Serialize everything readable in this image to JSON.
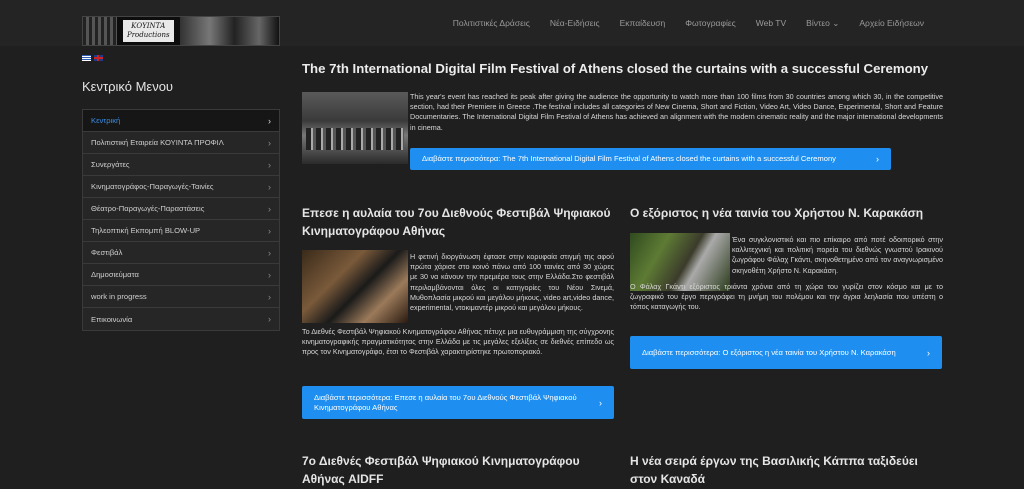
{
  "header": {
    "logo_text": "ΚΟΥΙΝΤΑ\nProductions",
    "nav": [
      "Πολιτιστικές Δράσεις",
      "Νέα-Ειδήσεις",
      "Εκπαίδευση",
      "Φωτογραφίες",
      "Web TV",
      "Βίντεο ⌄",
      "Αρχείο Ειδήσεων"
    ]
  },
  "sidebar": {
    "title": "Κεντρικό Μενου",
    "items": [
      "Κεντρική",
      "Πολιτιστική Εταιρεία ΚΟΥΙΝΤΑ ΠΡΟΦΙΛ",
      "Συνεργάτες",
      "Κινηματογράφος-Παραγωγές-Ταινίες",
      "Θέατρο-Παραγωγές-Παραστάσεις",
      "Τηλεοπτική Εκπομπή BLOW-UP",
      "Φεστιβάλ",
      "Δημοσιεύματα",
      "work in progress",
      "Επικοινωνία"
    ]
  },
  "articles": {
    "main": {
      "title": "The 7th International Digital Film Festival of Athens closed the curtains with a successful Ceremony",
      "text": "This year's event has reached its peak after giving the audience the opportunity to watch more than 100 films from 30 countries among which 30, in the competitive section, had their Premiere in Greece .The festival includes all categories of New Cinema, Short and Fiction, Video Art, Video Dance, Experimental, Short and Feature Documentaries. The International Digital Film Festival of Athens has achieved an alignment with the modern cinematic reality and the major international developments in cinema.",
      "button": "Διαβάστε περισσότερα: The 7th International Digital Film Festival of Athens closed the curtains with a successful Ceremony"
    },
    "left": {
      "title": "Επεσε η αυλαία του 7ου Διεθνούς Φεστιβάλ Ψηφιακού Κινηματογράφου Αθήνας",
      "text1": "Η φετινή  διοργάνωση έφτασε στην κορυφαία στιγμή της αφού πρώτα χάρισε στο  κοινό πάνω από 100 ταινίες από 30 χώρες με 30 να κάνουν την πρεμιέρα τους στην Ελλάδα.Στο φεστιβάλ περιλαμβάνονται όλες οι κατηγορίες του Νέου Σινεμά, Μυθοπλασία μικρού και μεγάλου μήκους, video art,video dance, experimental, ντοκιμαντέρ μικρού και μεγάλου μήκους.",
      "text2": "Το Διεθνές Φεστιβάλ Ψηφιακού Κινηματογράφου Αθήνας πέτυχε μια  ευθυγράμμιση της σύγχρονης κινηματογραφικής πραγματικότητας στην Ελλάδα με τις μεγάλες εξελίξεις σε διεθνές επίπεδο ως προς τον Κινηματογράφο, έτσι το Φεστιβάλ χαρακτηρίστηκε πρωτοποριακό.",
      "button": "Διαβάστε περισσότερα: Επεσε η αυλαία του 7ου Διεθνούς Φεστιβάλ Ψηφιακού Κινηματογράφου Αθήνας"
    },
    "right": {
      "title": "Ο εξόριστος η νέα ταινία του Χρήστου Ν. Καρακάση",
      "text1": "Ένα συγκλονιστικό και πιο επίκαιρο από ποτέ οδοιπορικό στην καλλιτεχνική και πολιτική πορεία του διεθνώς γνωστού Ιρακινού ζωγράφου Φάλαχ Γκάντι, σκηνοθετημένο από τον αναγνωρισμένο σκηνοθέτη Χρήστο Ν. Καρακάση.",
      "text2": "Ο Φάλαχ Γκάντι εξόριστος τριάντα χρόνια από τη χώρα του γυρίζει στον κόσμο και με το ζωγραφικό του έργο περιγράφει τη μνήμη του πολέμου και την άγρια λεηλασία που υπέστη ο τόπος καταγωγής του.",
      "button": "Διαβάστε περισσότερα: Ο εξόριστος η νέα ταινία του Χρήστου Ν. Καρακάση"
    },
    "bottom_left_title": "7ο Διεθνές Φεστιβάλ Ψηφιακού Κινηματογράφου Αθήνας AIDFF",
    "bottom_right_title": "Η νέα σειρά έργων της Βασιλικής Κάππα ταξιδεύει στον Καναδά"
  }
}
